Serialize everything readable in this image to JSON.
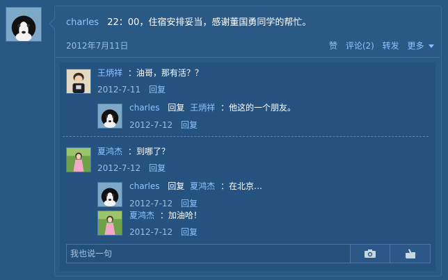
{
  "post": {
    "author": "charles",
    "text": "22：00，住宿安排妥当，感谢董国勇同学的帮忙。",
    "date": "2012年7月11日",
    "actions": {
      "like": "赞",
      "comment": "评论(2)",
      "forward": "转发",
      "more": "更多"
    }
  },
  "comments": [
    {
      "author": "王炳祥",
      "text": "：油哥，那有活？？",
      "date": "2012-7-11",
      "reply_label": "回复",
      "replies": [
        {
          "author": "charles",
          "reply_word": "回复",
          "target": "王炳祥",
          "text": "：他这的一个朋友。",
          "date": "2012-7-12",
          "reply_label": "回复"
        }
      ]
    },
    {
      "author": "夏鸿杰",
      "text": "：到哪了？",
      "date": "2012-7-12",
      "reply_label": "回复",
      "replies": [
        {
          "author": "charles",
          "reply_word": "回复",
          "target": "夏鸿杰",
          "text": "：在北京…",
          "date": "2012-7-12",
          "reply_label": "回复"
        },
        {
          "author": "夏鸿杰",
          "text": "：加油哈！",
          "date": "2012-7-12",
          "reply_label": "回复"
        }
      ]
    }
  ],
  "composer": {
    "placeholder": "我也说一句",
    "camera_icon": "camera-icon",
    "thumb_icon": "thumbs-up-icon"
  },
  "colors": {
    "background": "#295783",
    "link": "#8cc4ff",
    "meta": "#9dbedc"
  }
}
